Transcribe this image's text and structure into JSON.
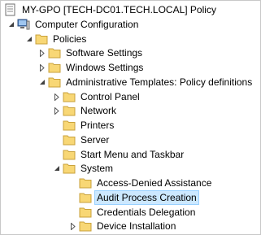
{
  "tree": {
    "root": "MY-GPO [TECH-DC01.TECH.LOCAL] Policy",
    "computer_configuration": "Computer Configuration",
    "policies": "Policies",
    "software_settings": "Software Settings",
    "windows_settings": "Windows Settings",
    "administrative_templates": "Administrative Templates: Policy definitions",
    "control_panel": "Control Panel",
    "network": "Network",
    "printers": "Printers",
    "server": "Server",
    "start_menu": "Start Menu and Taskbar",
    "system": "System",
    "access_denied": "Access-Denied Assistance",
    "audit_process": "Audit Process Creation",
    "credentials_delegation": "Credentials Delegation",
    "device_installation": "Device Installation"
  },
  "selected_item": "Audit Process Creation",
  "colors": {
    "folder_fill": "#f8d775",
    "folder_stroke": "#c9a23c",
    "selection_bg": "#cce8ff",
    "selection_border": "#99d1ff"
  }
}
